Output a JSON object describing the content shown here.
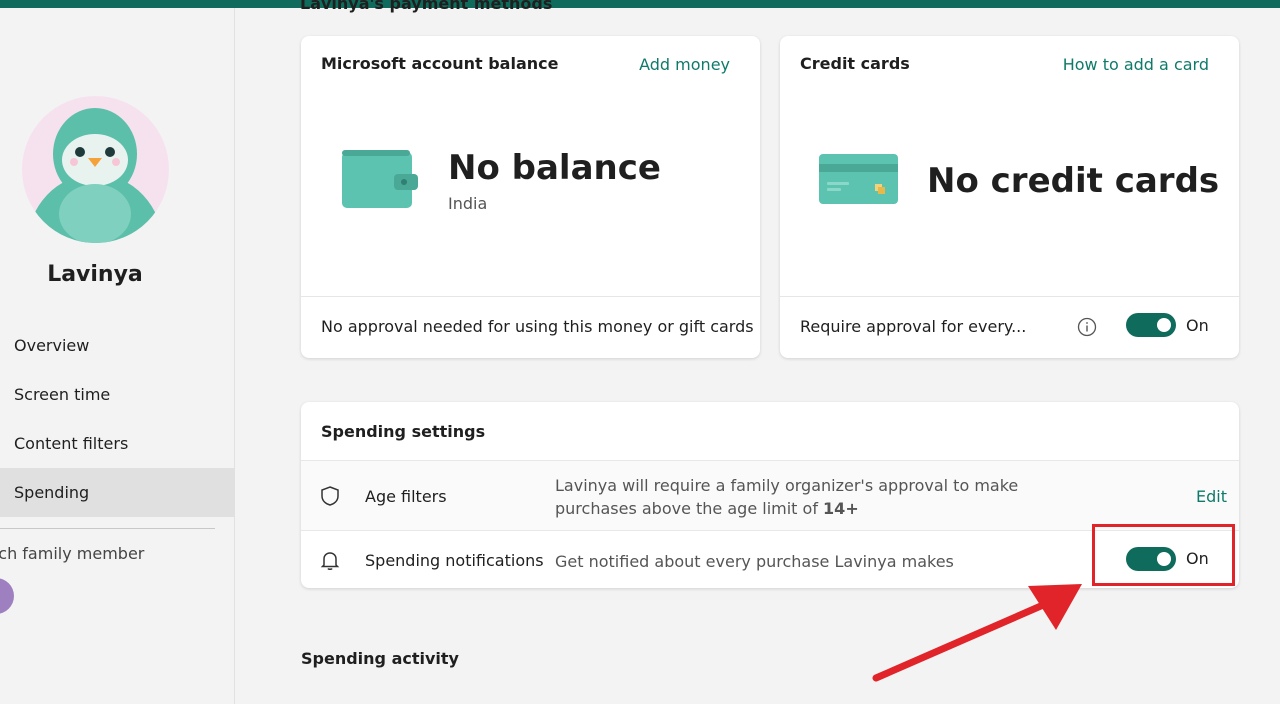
{
  "profile": {
    "name": "Lavinya"
  },
  "nav": {
    "items": [
      {
        "label": "Overview"
      },
      {
        "label": "Screen time"
      },
      {
        "label": "Content filters"
      },
      {
        "label": "Spending"
      }
    ],
    "switch_label": "tch family member"
  },
  "payment": {
    "section_title": "Lavinya's payment methods",
    "balance_card": {
      "title": "Microsoft account balance",
      "link": "Add money",
      "amount": "No balance",
      "region": "India",
      "footer": "No approval needed for using this money or gift cards"
    },
    "credit_card": {
      "title": "Credit cards",
      "link": "How to add a card",
      "status": "No credit cards",
      "footer": "Require approval for every...",
      "toggle_label": "On",
      "toggle_on": true
    }
  },
  "spending_settings": {
    "title": "Spending settings",
    "rows": [
      {
        "label": "Age filters",
        "desc_line1": "Lavinya will require a family organizer's approval to make",
        "desc_line2_prefix": "purchases above the age limit of ",
        "age_limit": "14+",
        "action": "Edit",
        "icon": "shield-icon"
      },
      {
        "label": "Spending notifications",
        "desc": "Get notified about every purchase Lavinya makes",
        "toggle_label": "On",
        "toggle_on": true,
        "icon": "bell-icon"
      }
    ]
  },
  "spending_activity": {
    "title": "Spending activity"
  },
  "colors": {
    "accent": "#0f6b5c",
    "link": "#0f7a6a",
    "annotation": "#e0242a"
  }
}
